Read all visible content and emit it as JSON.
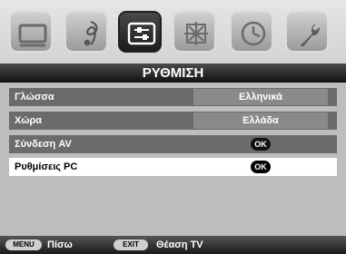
{
  "top_icons": [
    {
      "name": "screen-icon"
    },
    {
      "name": "music-note-icon"
    },
    {
      "name": "settings-sliders-icon",
      "active": true
    },
    {
      "name": "tools-grid-icon"
    },
    {
      "name": "clock-icon"
    },
    {
      "name": "wrench-icon"
    }
  ],
  "header": {
    "title": "ΡΥΘΜΙΣΗ"
  },
  "menu": {
    "rows": [
      {
        "label": "Γλώσσα",
        "value": "Ελληνικά"
      },
      {
        "label": "Χώρα",
        "value": "Ελλάδα"
      },
      {
        "label": "Σύνδεση AV",
        "value": "OK"
      },
      {
        "label": "Ρυθμίσεις PC",
        "value": "OK"
      }
    ]
  },
  "footer": {
    "menu_key": "MENU",
    "back_label": "Πίσω",
    "exit_key": "EXIT",
    "watch_tv_label": "Θέαση TV"
  },
  "colors": {
    "title_bar": "#111111",
    "row_dark": "#6b6b6b",
    "row_selected": "#ffffff",
    "ok_badge": "#000000"
  }
}
